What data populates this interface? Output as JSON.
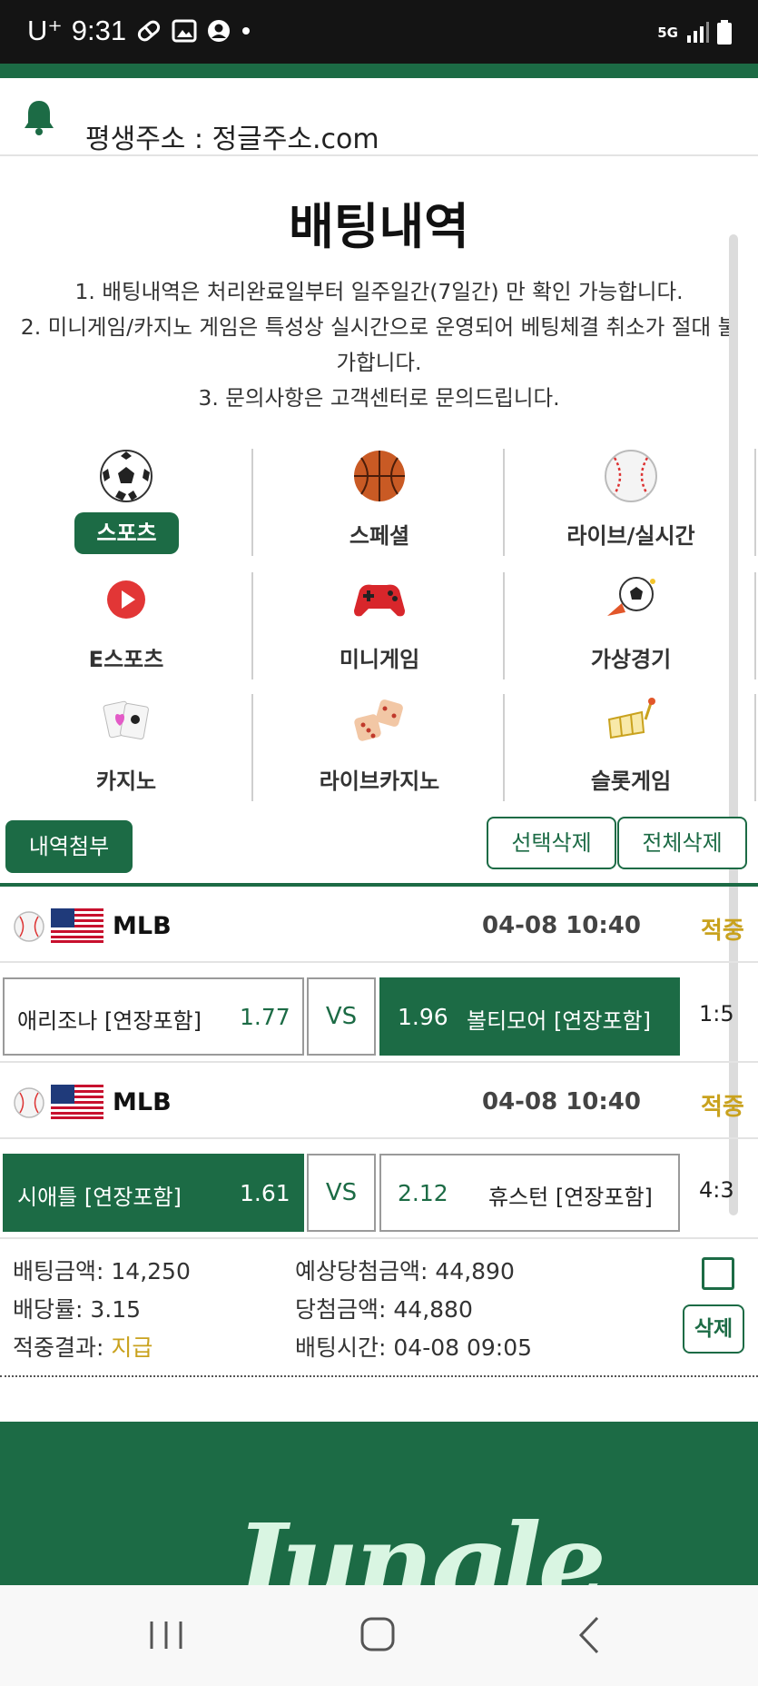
{
  "status_bar": {
    "carrier": "U⁺",
    "time": "9:31",
    "network": "5G"
  },
  "notice": {
    "text": "평생주소 : 정글주소.com"
  },
  "page_title": "배팅내역",
  "rules": [
    "1. 배팅내역은 처리완료일부터 일주일간(7일간) 만 확인 가능합니다.",
    "2. 미니게임/카지노 게임은 특성상 실시간으로 운영되어 베팅체결 취소가 절대 불가합니다.",
    "3. 문의사항은 고객센터로 문의드립니다."
  ],
  "categories": [
    {
      "label": "스포츠",
      "icon": "soccer-ball-icon",
      "active": true
    },
    {
      "label": "스페셜",
      "icon": "basketball-icon",
      "active": false
    },
    {
      "label": "라이브/실시간",
      "icon": "baseball-icon",
      "active": false
    },
    {
      "label": "E스포츠",
      "icon": "play-icon",
      "active": false
    },
    {
      "label": "미니게임",
      "icon": "gamepad-icon",
      "active": false
    },
    {
      "label": "가상경기",
      "icon": "soccer-kick-icon",
      "active": false
    },
    {
      "label": "카지노",
      "icon": "cards-icon",
      "active": false
    },
    {
      "label": "라이브카지노",
      "icon": "dice-icon",
      "active": false
    },
    {
      "label": "슬롯게임",
      "icon": "slot-icon",
      "active": false
    }
  ],
  "actions": {
    "attach": "내역첨부",
    "delete_selected": "선택삭제",
    "delete_all": "전체삭제"
  },
  "bets": [
    {
      "league": "MLB",
      "datetime": "04-08 10:40",
      "status": "적중",
      "home": "애리조나 [연장포함]",
      "home_odds": "1.77",
      "vs": "VS",
      "away_odds": "1.96",
      "away": "볼티모어 [연장포함]",
      "score": "1:5",
      "selected": "away"
    },
    {
      "league": "MLB",
      "datetime": "04-08 10:40",
      "status": "적중",
      "home": "시애틀 [연장포함]",
      "home_odds": "1.61",
      "vs": "VS",
      "away_odds": "2.12",
      "away": "휴스턴 [연장포함]",
      "score": "4:3",
      "selected": "home"
    }
  ],
  "summary": {
    "bet_amount_label": "배팅금액:",
    "bet_amount": "14,250",
    "odds_label": "배당률:",
    "odds": "3.15",
    "result_label": "적중결과:",
    "result": "지급",
    "expected_label": "예상당첨금액:",
    "expected": "44,890",
    "win_label": "당첨금액:",
    "win": "44,880",
    "time_label": "배팅시간:",
    "time": "04-08 09:05",
    "delete": "삭제"
  },
  "footer": {
    "logo": "Jungle"
  },
  "colors": {
    "brand_green": "#1c6b45",
    "gold": "#c9a21e"
  }
}
